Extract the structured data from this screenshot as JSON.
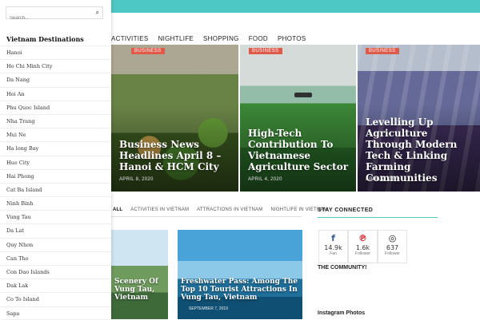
{
  "nav": {
    "items": [
      "ACTIVITIES",
      "NIGHTLIFE",
      "SHOPPING",
      "FOOD",
      "PHOTOS"
    ]
  },
  "hero": [
    {
      "badge": "BUSINESS",
      "title": "Business News Headlines April 8 – Hanoi & HCM City",
      "date": "APRIL 8, 2020"
    },
    {
      "badge": "BUSINESS",
      "title": "High-Tech Contribution To Vietnamese Agriculture Sector",
      "date": "APRIL 4, 2020"
    },
    {
      "badge": "BUSINESS",
      "title": "Levelling Up Agriculture Through Modern Tech & Linking Farming Communities",
      "date": "APRIL 2, 2020"
    }
  ],
  "tabs": [
    "ALL",
    "ACTIVITIES IN VIETNAM",
    "ATTRACTIONS IN VIETNAM",
    "NIGHTLIFE IN VIETNAM"
  ],
  "cards": [
    {
      "title": "Scenery Of Vung Tau, Vietnam",
      "date": ""
    },
    {
      "title": "Freshwater Pass: Among The Top 10 Tourist Attractions In Vung Tau, Vietnam",
      "date": "SEPTEMBER 7, 2019"
    }
  ],
  "sidebar_right": {
    "stay_connected": "STAY CONNECTED",
    "social": [
      {
        "icon": "facebook-icon",
        "glyph": "f",
        "count": "14.9k",
        "label": "Fan",
        "color": "#3b5998"
      },
      {
        "icon": "pinterest-icon",
        "glyph": "℗",
        "count": "1.6k",
        "label": "Follower",
        "color": "#cb2027"
      },
      {
        "icon": "instagram-icon",
        "glyph": "◎",
        "count": "637",
        "label": "Follower",
        "color": "#222222"
      }
    ],
    "community": "THE COMMUNITY!",
    "instagram_title": "Instagram Photos"
  },
  "panel": {
    "search_placeholder": "Search...",
    "title": "Vietnam Destinations",
    "destinations": [
      "Hanoi",
      "Ho Chi Minh City",
      "Da Nang",
      "Hoi An",
      "Phu Quoc Island",
      "Nha Trang",
      "Mui Ne",
      "Ha long Bay",
      "Hue City",
      "Hai Phong",
      "Cat Ba Island",
      "Ninh Binh",
      "Vung Tau",
      "Da Lat",
      "Quy Nhon",
      "Can Tho",
      "Con Dao Islands",
      "Dak Lak",
      "Co To Island",
      "Sapa"
    ]
  },
  "colors": {
    "accent": "#4ec8c4",
    "badge": "#e05a4a"
  }
}
